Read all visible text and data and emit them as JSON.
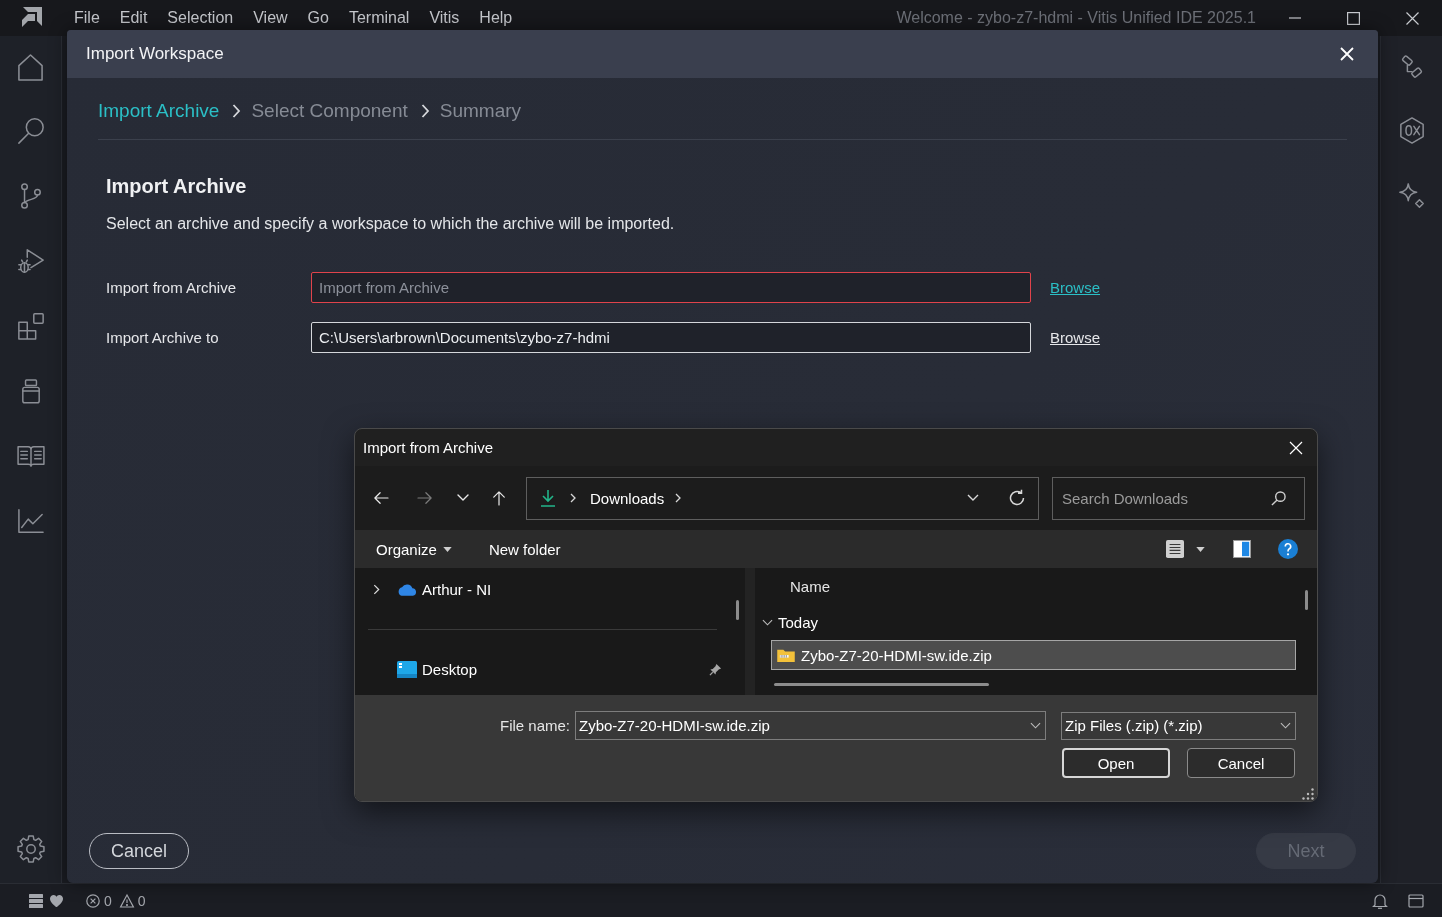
{
  "window": {
    "title": "Welcome - zybo-z7-hdmi - Vitis Unified IDE 2025.1"
  },
  "menu": [
    "File",
    "Edit",
    "Selection",
    "View",
    "Go",
    "Terminal",
    "Vitis",
    "Help"
  ],
  "import_workspace": {
    "title": "Import Workspace",
    "steps": [
      {
        "label": "Import Archive",
        "selected": true
      },
      {
        "label": "Select Component",
        "selected": false
      },
      {
        "label": "Summary",
        "selected": false
      }
    ],
    "heading": "Import Archive",
    "description": "Select an archive and specify a workspace to which the archive will be imported.",
    "fields": [
      {
        "label": "Import from Archive",
        "placeholder": "Import from Archive",
        "invalid": true,
        "browse": {
          "label": "Browse",
          "focused": true
        }
      },
      {
        "label": "Import Archive to",
        "value": "C:\\Users\\arbrown\\Documents\\zybo-z7-hdmi",
        "invalid": false,
        "browse": {
          "label": "Browse",
          "focused": false
        }
      }
    ],
    "buttons": [
      {
        "label": "Cancel",
        "disabled": false
      },
      {
        "label": "Next",
        "disabled": true
      }
    ]
  },
  "file_dialog": {
    "title": "Import from Archive",
    "nav_buttons": [
      {
        "kind": "back",
        "disabled": false
      },
      {
        "kind": "forward",
        "disabled": true
      },
      {
        "kind": "recent",
        "disabled": false
      },
      {
        "kind": "up",
        "disabled": false
      }
    ],
    "address": [
      "Downloads"
    ],
    "search": {
      "placeholder": "Search Downloads"
    },
    "commands": [
      {
        "label": "Organize",
        "dropdown": true
      },
      {
        "label": "New folder",
        "dropdown": false
      }
    ],
    "nav_pane": [
      {
        "label": "Arthur - NI",
        "kind": "cloud",
        "expandable": true,
        "pinned": false
      },
      {
        "label": "Desktop",
        "kind": "desktop",
        "expandable": false,
        "pinned": true
      }
    ],
    "columns": [
      "Name"
    ],
    "groups": [
      {
        "label": "Today",
        "expanded": true,
        "files": [
          {
            "name": "Zybo-Z7-20-HDMI-sw.ide.zip",
            "selected": true
          }
        ]
      }
    ],
    "file_name": {
      "label": "File name:",
      "value": "Zybo-Z7-20-HDMI-sw.ide.zip"
    },
    "file_type": "Zip Files (.zip) (*.zip)",
    "buttons": [
      {
        "label": "Open",
        "default": true
      },
      {
        "label": "Cancel",
        "default": false
      }
    ]
  },
  "status_bar": {
    "problems": [
      {
        "kind": "error",
        "count": "0"
      },
      {
        "kind": "warning",
        "count": "0"
      }
    ]
  }
}
